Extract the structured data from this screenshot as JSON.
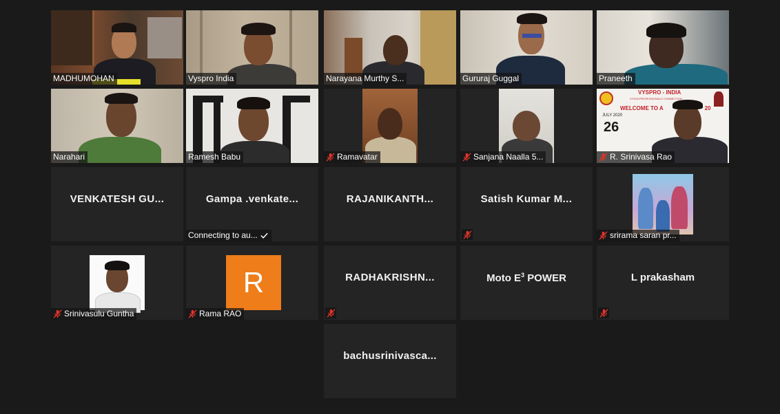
{
  "participants": [
    {
      "name": "MADHUMOHAN",
      "muted": false
    },
    {
      "name": "Vyspro India",
      "muted": false,
      "active_speaker": true
    },
    {
      "name": "Narayana Murthy S...",
      "muted": false
    },
    {
      "name": "Gururaj Guggal",
      "muted": false
    },
    {
      "name": "Praneeth",
      "muted": false
    },
    {
      "name": "Narahari",
      "muted": false
    },
    {
      "name": "Ramesh Babu",
      "muted": false
    },
    {
      "name": "Ramavatar",
      "muted": true
    },
    {
      "name": "Sanjana Naalla 5...",
      "muted": true
    },
    {
      "name": "R. Srinivasa Rao",
      "muted": true
    },
    {
      "display_name": "VENKATESH GU...",
      "muted": false
    },
    {
      "display_name": "Gampa .venkate...",
      "status": "Connecting to au...",
      "muted": false
    },
    {
      "display_name": "RAJANIKANTH...",
      "muted": false
    },
    {
      "display_name": "Satish Kumar M...",
      "muted": true
    },
    {
      "name": "srirama saran pr...",
      "muted": true
    },
    {
      "name": "Srinivasulu Guntha",
      "muted": true
    },
    {
      "name": "Rama RAO",
      "muted": true,
      "avatar_letter": "R"
    },
    {
      "display_name": "RADHAKRISHN...",
      "muted": true
    },
    {
      "display_name": "Moto E",
      "display_sup": "3",
      "display_suffix": " POWER",
      "muted": false
    },
    {
      "display_name": "L prakasham",
      "muted": true
    },
    {
      "display_name": "bachusrinivasca...",
      "muted": false
    }
  ],
  "poster": {
    "org": "VYSPRO - INDIA",
    "sub": "VYSYA PROFESSIONALS CONNECTION",
    "welcome": "WELCOME TO A",
    "tail": "20",
    "month": "JULY 2020",
    "day": "26"
  },
  "colors": {
    "active_border": "#b7d94a",
    "tile_bg": "#242424",
    "muted_red": "#e0342b",
    "avatar_orange": "#ee7d1a"
  }
}
